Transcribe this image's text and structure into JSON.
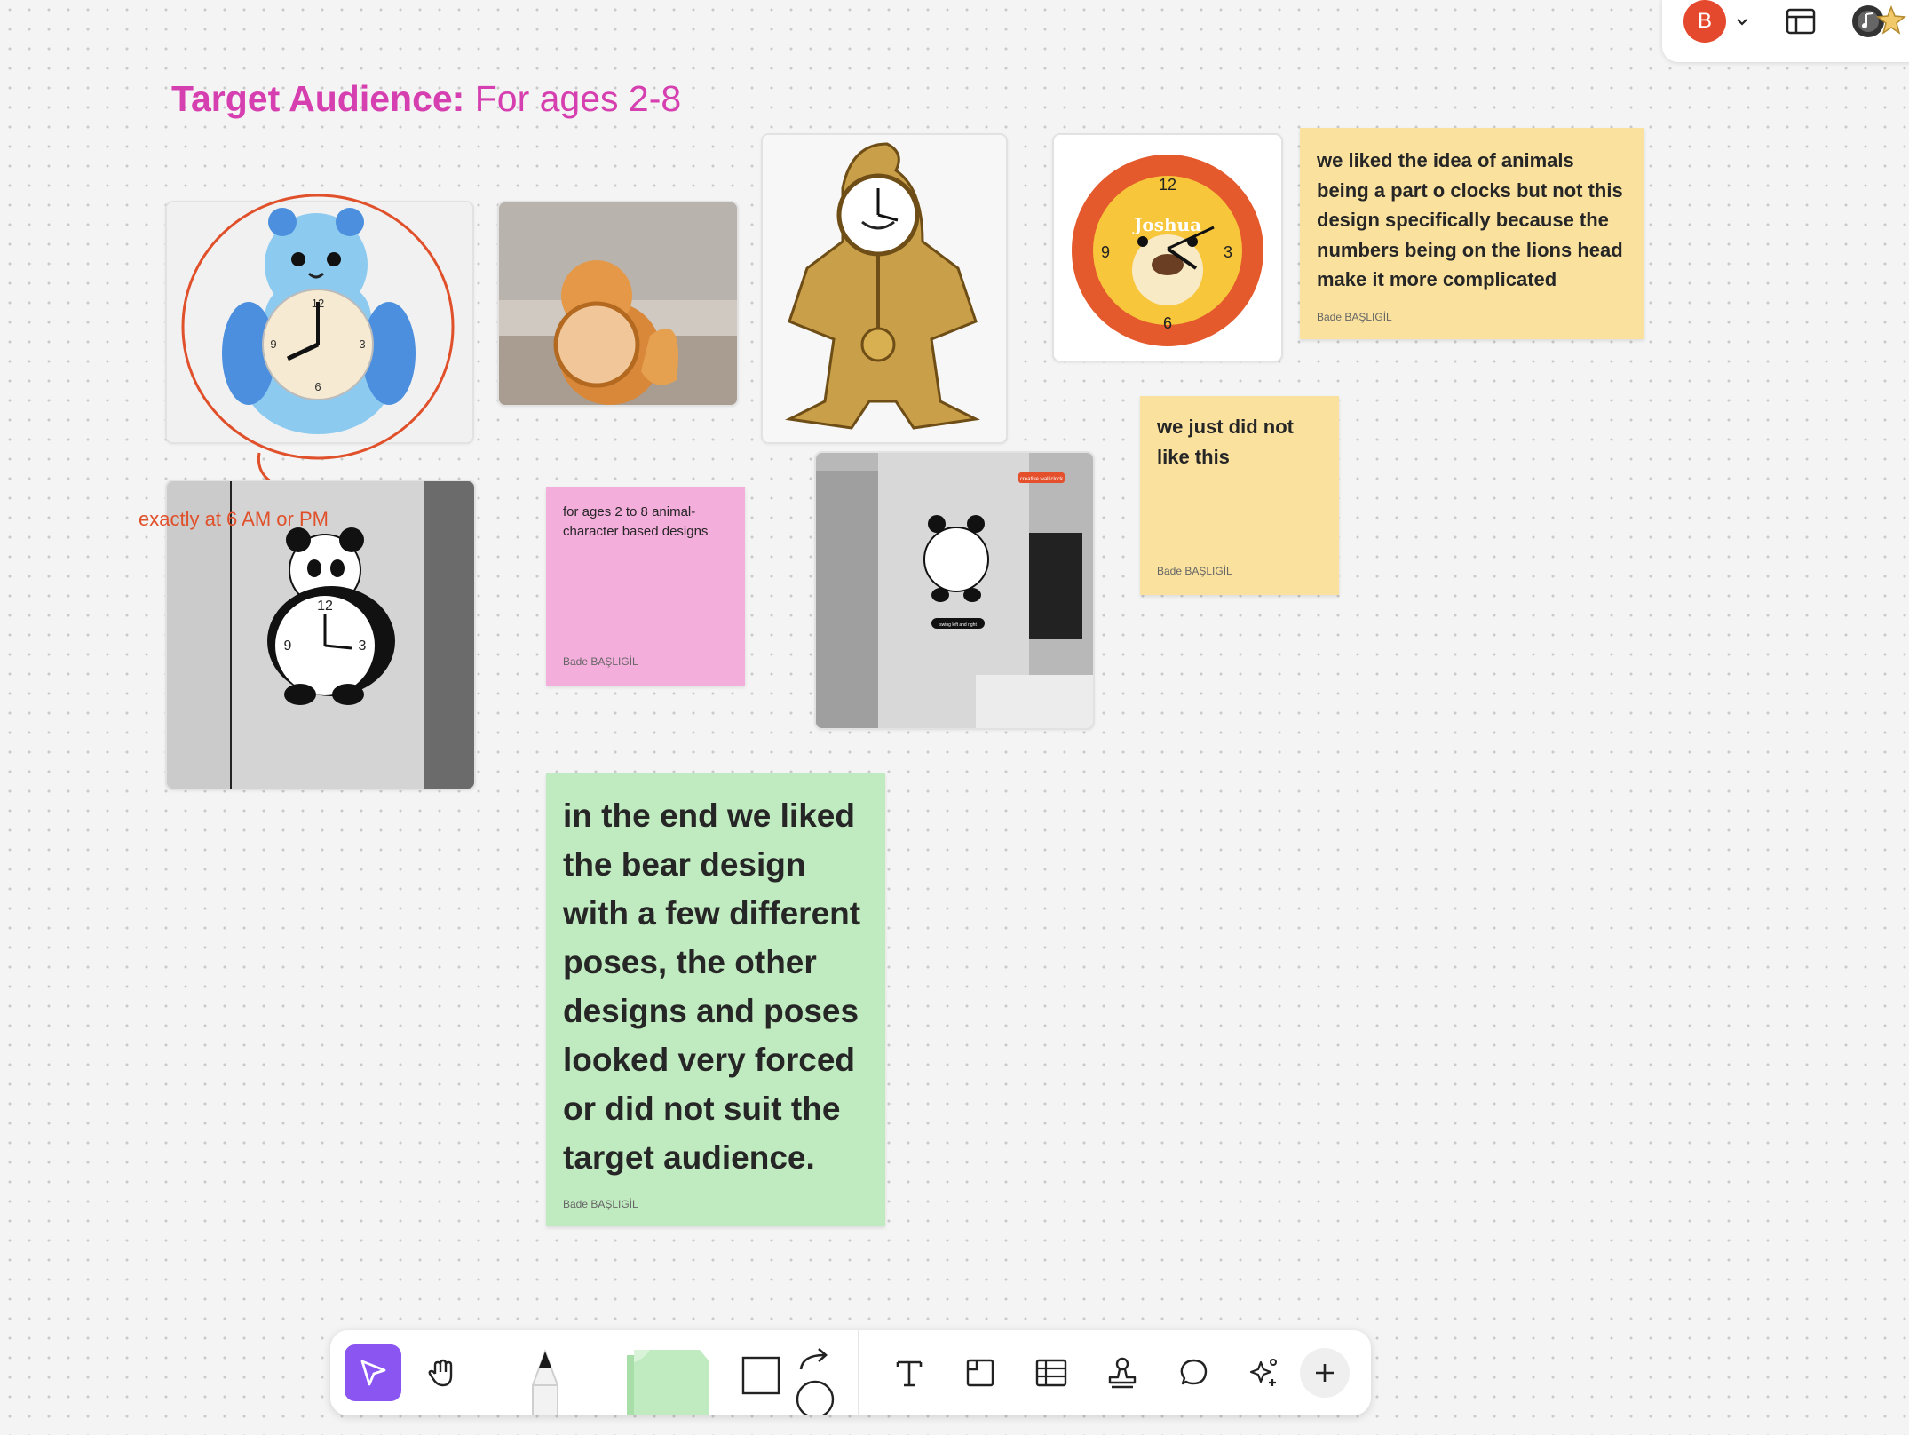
{
  "board": {
    "title_bold": "Target Audience:",
    "title_rest": " For ages 2-8"
  },
  "annotation": {
    "text": "exactly at 6 AM or PM",
    "color": "#e0502a"
  },
  "stickies": {
    "lion_note": {
      "text": "we liked the idea of animals being a part o clocks but not this design specifically because the numbers being on the lions head make it more complicated",
      "author": "Bade BAŞLIGİL",
      "color": "#fae29e"
    },
    "dislike_note": {
      "text": "we just did not like this",
      "author": "Bade BAŞLIGİL",
      "color": "#fae29e"
    },
    "ages_note": {
      "text": "for ages 2 to 8 animal-character based designs",
      "author": "Bade BAŞLIGİL",
      "color": "#f4aedc"
    },
    "conclusion_note": {
      "text": "in the end we liked the bear design with a few different poses, the other designs and poses looked very forced or did not suit the target audience.",
      "author": "Bade BAŞLIGİL",
      "color": "#c0ebc0"
    }
  },
  "images": {
    "bear": "blue bear wall clock",
    "fox": "orange fox alarm clock",
    "wooden": "wooden pendulum clock",
    "lion": "lion face clock",
    "lion_name": "Joshua",
    "panda": "panda wall clock",
    "panda_room": "panda wall clock in room",
    "panda_room_badge": "creative wall clock",
    "panda_room_caption": "swing left and right"
  },
  "topbar": {
    "avatar_initial": "B",
    "accent": "#e5492d"
  },
  "toolbar": {
    "accent": "#8b55f2",
    "tools": [
      "select-tool",
      "hand-tool",
      "pen-tool",
      "sticky-note-tool",
      "shape-tool",
      "connector-tool",
      "text-tool",
      "section-tool",
      "table-tool",
      "stamp-tool",
      "comment-tool",
      "ai-tool",
      "more-tools"
    ]
  }
}
